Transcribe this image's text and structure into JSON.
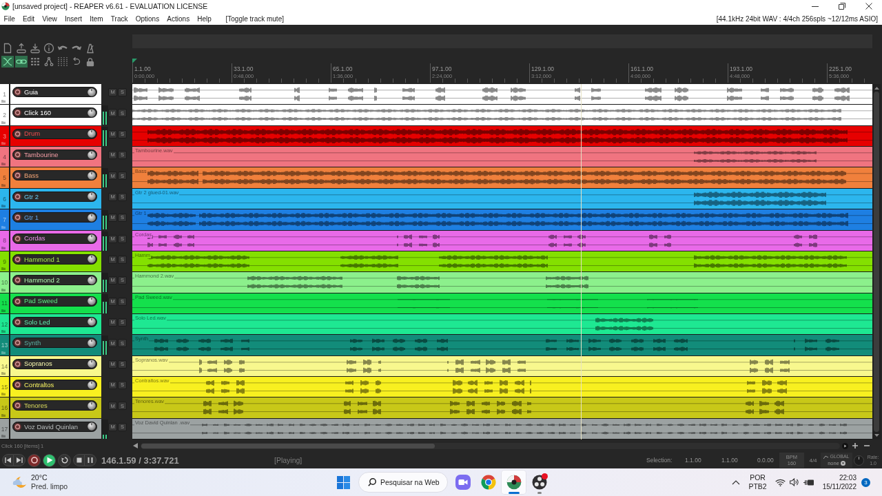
{
  "window": {
    "title": "[unsaved project] - REAPER v6.61 - EVALUATION LICENSE"
  },
  "menu": {
    "items": [
      "File",
      "Edit",
      "View",
      "Insert",
      "Item",
      "Track",
      "Options",
      "Actions",
      "Help"
    ],
    "last_action": "[Toggle track mute]",
    "audio_status": "[44.1kHz 24bit WAV : 4/4ch 256spls ~12/12ms ASIO]"
  },
  "toolbar": {
    "actions": [
      {
        "kind": "new"
      },
      {
        "kind": "open"
      },
      {
        "kind": "save"
      },
      {
        "kind": "info"
      },
      {
        "kind": "undo"
      },
      {
        "kind": "redo"
      },
      {
        "kind": "metronome"
      }
    ],
    "toggles": [
      {
        "kind": "crossfade",
        "on": true
      },
      {
        "kind": "grouping",
        "on": true
      },
      {
        "kind": "grid",
        "on": false
      },
      {
        "kind": "envelope",
        "on": false
      },
      {
        "kind": "snap",
        "on": false
      },
      {
        "kind": "loop",
        "on": false
      },
      {
        "kind": "lock",
        "on": false
      }
    ]
  },
  "ruler": {
    "markers": [
      {
        "bar": "1.1.00",
        "time": "0:00.000"
      },
      {
        "bar": "33.1.00",
        "time": "0:48.000"
      },
      {
        "bar": "65.1.00",
        "time": "1:36.000"
      },
      {
        "bar": "97.1.00",
        "time": "2:24.000"
      },
      {
        "bar": "129.1.00",
        "time": "3:12.000"
      },
      {
        "bar": "161.1.00",
        "time": "4:00.000"
      },
      {
        "bar": "193.1.00",
        "time": "4:48.000"
      },
      {
        "bar": "225.1.00",
        "time": "5:36.000"
      }
    ]
  },
  "tracks": [
    {
      "number": "1",
      "name": "Guia",
      "color": "#ffffff",
      "muted": false,
      "soloed": false,
      "mute_label": "M",
      "solo_label": "S"
    },
    {
      "number": "2",
      "name": "Click 160",
      "color": "#ffffff",
      "level": 0.7,
      "muted": false,
      "soloed": false,
      "mute_label": "M",
      "solo_label": "S"
    },
    {
      "number": "3",
      "name": "Drum",
      "color": "#e60000",
      "level": 0.8,
      "muted": false,
      "soloed": false,
      "mute_label": "M",
      "solo_label": "S"
    },
    {
      "number": "4",
      "name": "Tambourine",
      "color": "#f07480",
      "muted": false,
      "soloed": false,
      "mute_label": "M",
      "solo_label": "S",
      "item_label": "Tambourine.wav"
    },
    {
      "number": "5",
      "name": "Bass",
      "color": "#f0803c",
      "level": 0.7,
      "muted": false,
      "soloed": false,
      "mute_label": "M",
      "solo_label": "S",
      "item_label": "Bass"
    },
    {
      "number": "6",
      "name": "Gtr 2",
      "color": "#2cb6ee",
      "muted": false,
      "soloed": false,
      "mute_label": "M",
      "solo_label": "S",
      "item_label": "Gtr 2 glued-01.wav"
    },
    {
      "number": "7",
      "name": "Gtr 1",
      "color": "#1e7fe2",
      "level": 0.72,
      "muted": false,
      "soloed": false,
      "mute_label": "M",
      "solo_label": "S",
      "item_label": "Gtr 1"
    },
    {
      "number": "8",
      "name": "Cordas",
      "color": "#e86ae8",
      "level": 0.72,
      "muted": false,
      "soloed": false,
      "mute_label": "M",
      "solo_label": "S",
      "item_label": "Cordas"
    },
    {
      "number": "9",
      "name": "Hammond 1",
      "color": "#84e000",
      "muted": false,
      "soloed": false,
      "mute_label": "M",
      "solo_label": "S",
      "item_label": "Hamm"
    },
    {
      "number": "10",
      "name": "Hammond 2",
      "color": "#8cf08c",
      "level": 0.65,
      "muted": false,
      "soloed": false,
      "mute_label": "M",
      "solo_label": "S",
      "item_label": "Hammond 2.wav"
    },
    {
      "number": "11",
      "name": "Pad Sweed",
      "color": "#14e04c",
      "level": 0.6,
      "muted": false,
      "soloed": false,
      "mute_label": "M",
      "solo_label": "S",
      "item_label": "Pad Sweed.wav"
    },
    {
      "number": "12",
      "name": "Solo Led",
      "color": "#1ee892",
      "muted": false,
      "soloed": false,
      "mute_label": "M",
      "solo_label": "S",
      "item_label": "Solo Led.wav"
    },
    {
      "number": "13",
      "name": "Synth",
      "color": "#128c7a",
      "level": 0.72,
      "muted": false,
      "soloed": false,
      "mute_label": "M",
      "solo_label": "S",
      "item_label": "Synth"
    },
    {
      "number": "14",
      "name": "Sopranos",
      "color": "#f8f88e",
      "muted": false,
      "soloed": false,
      "mute_label": "M",
      "solo_label": "S",
      "item_label": "Sopranos.wav"
    },
    {
      "number": "15",
      "name": "Contraltos",
      "color": "#f8f020",
      "muted": false,
      "soloed": false,
      "mute_label": "M",
      "solo_label": "S",
      "item_label": "Contraltos.wav"
    },
    {
      "number": "16",
      "name": "Tenores",
      "color": "#c8c818",
      "muted": false,
      "soloed": false,
      "mute_label": "M",
      "solo_label": "S",
      "item_label": "Tenores.wav"
    },
    {
      "number": "17",
      "name": "Voz David Quinlan",
      "color": "#9ca2a2",
      "level": 0.2,
      "muted": false,
      "soloed": false,
      "mute_label": "M",
      "solo_label": "S",
      "item_label": "Voz David Quinlan .wav"
    }
  ],
  "playhead": {
    "level": 0.606
  },
  "status_bar": {
    "text": "Click 160 [items] 1"
  },
  "transport": {
    "buttons": [
      {
        "kind": "skip-back",
        "on": false
      },
      {
        "kind": "skip-forward",
        "on": false
      },
      {
        "kind": "record",
        "on": false
      },
      {
        "kind": "play",
        "on": true
      },
      {
        "kind": "repeat",
        "on": false
      },
      {
        "kind": "stop",
        "on": false
      },
      {
        "kind": "pause",
        "on": false
      }
    ],
    "position": "146.1.59 / 3:37.721",
    "state": "[Playing]",
    "selection_label": "Selection:",
    "selection_start": "1.1.00",
    "selection_end": "1.1.00",
    "selection_length": "0.0.00",
    "bpm_label": "BPM",
    "bpm": "160",
    "time_signature": "4/4",
    "automation_label": "GLOBAL",
    "automation_mode": "none",
    "rate_label": "Rate:",
    "rate": "1.0"
  },
  "taskbar": {
    "weather": {
      "temperature": "20°C",
      "condition": "Pred. limpo"
    },
    "search_label": "Pesquisar na Web",
    "apps": [
      {
        "kind": "video-call",
        "selected": false,
        "running": false,
        "alert": false
      },
      {
        "kind": "browser",
        "selected": false,
        "running": false,
        "alert": false
      },
      {
        "kind": "daw",
        "selected": true,
        "running": true,
        "alert": false
      },
      {
        "kind": "recorder",
        "selected": false,
        "running": true,
        "alert": true
      }
    ],
    "language": "POR",
    "keyboard": "PTB2",
    "time": "22:03",
    "date": "15/11/2022",
    "notifications": "3"
  }
}
